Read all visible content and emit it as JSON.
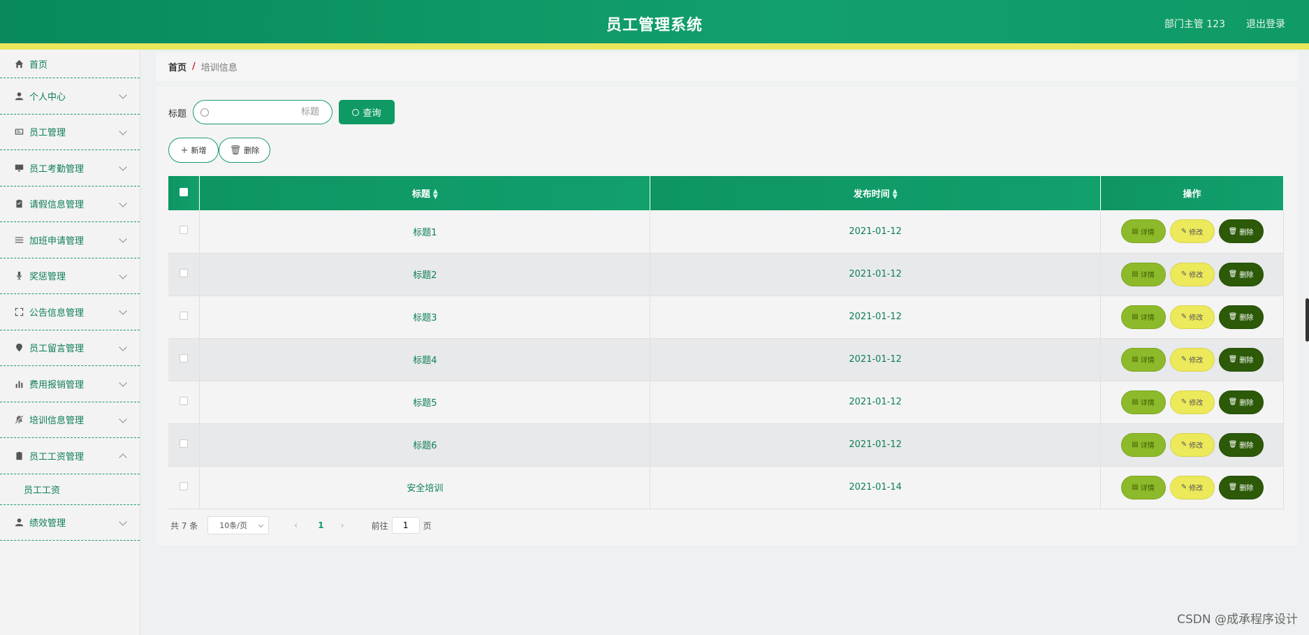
{
  "header": {
    "title": "员工管理系统",
    "user": "部门主管 123",
    "logout": "退出登录"
  },
  "sidebar": {
    "items": [
      {
        "label": "首页",
        "icon": "home-icon"
      },
      {
        "label": "个人中心",
        "icon": "user-icon"
      },
      {
        "label": "员工管理",
        "icon": "id-card-icon"
      },
      {
        "label": "员工考勤管理",
        "icon": "monitor-icon"
      },
      {
        "label": "请假信息管理",
        "icon": "clipboard-check-icon"
      },
      {
        "label": "加班申请管理",
        "icon": "list-icon"
      },
      {
        "label": "奖惩管理",
        "icon": "microphone-icon"
      },
      {
        "label": "公告信息管理",
        "icon": "fullscreen-icon"
      },
      {
        "label": "员工留言管理",
        "icon": "location-pin-icon"
      },
      {
        "label": "费用报销管理",
        "icon": "bar-chart-icon"
      },
      {
        "label": "培训信息管理",
        "icon": "bell-off-icon"
      },
      {
        "label": "员工工资管理",
        "icon": "clipboard-icon"
      },
      {
        "label": "绩效管理",
        "icon": "user-icon"
      }
    ],
    "submenu": {
      "label": "员工工资"
    }
  },
  "breadcrumb": {
    "home": "首页",
    "separator": "/",
    "current": "培训信息"
  },
  "search": {
    "label": "标题",
    "placeholder": "标题",
    "button": "查询"
  },
  "actions": {
    "add": "新增",
    "delete": "删除"
  },
  "table": {
    "headers": {
      "title": "标题",
      "date": "发布时间",
      "op": "操作"
    },
    "rows": [
      {
        "title": "标题1",
        "date": "2021-01-12"
      },
      {
        "title": "标题2",
        "date": "2021-01-12"
      },
      {
        "title": "标题3",
        "date": "2021-01-12"
      },
      {
        "title": "标题4",
        "date": "2021-01-12"
      },
      {
        "title": "标题5",
        "date": "2021-01-12"
      },
      {
        "title": "标题6",
        "date": "2021-01-12"
      },
      {
        "title": "安全培训",
        "date": "2021-01-14"
      }
    ],
    "op_labels": {
      "detail": "详情",
      "edit": "修改",
      "delete": "删除"
    }
  },
  "pagination": {
    "total": "共 7 条",
    "page_size": "10条/页",
    "current": "1",
    "goto": "前往",
    "goto_value": "1",
    "page_suffix": "页"
  },
  "watermark": "CSDN @成承程序设计",
  "colors": {
    "primary": "#0f9a64",
    "accent_strip": "#e8e65a",
    "detail": "#8dba2a",
    "edit": "#ece95a",
    "delete": "#2c5a08"
  }
}
